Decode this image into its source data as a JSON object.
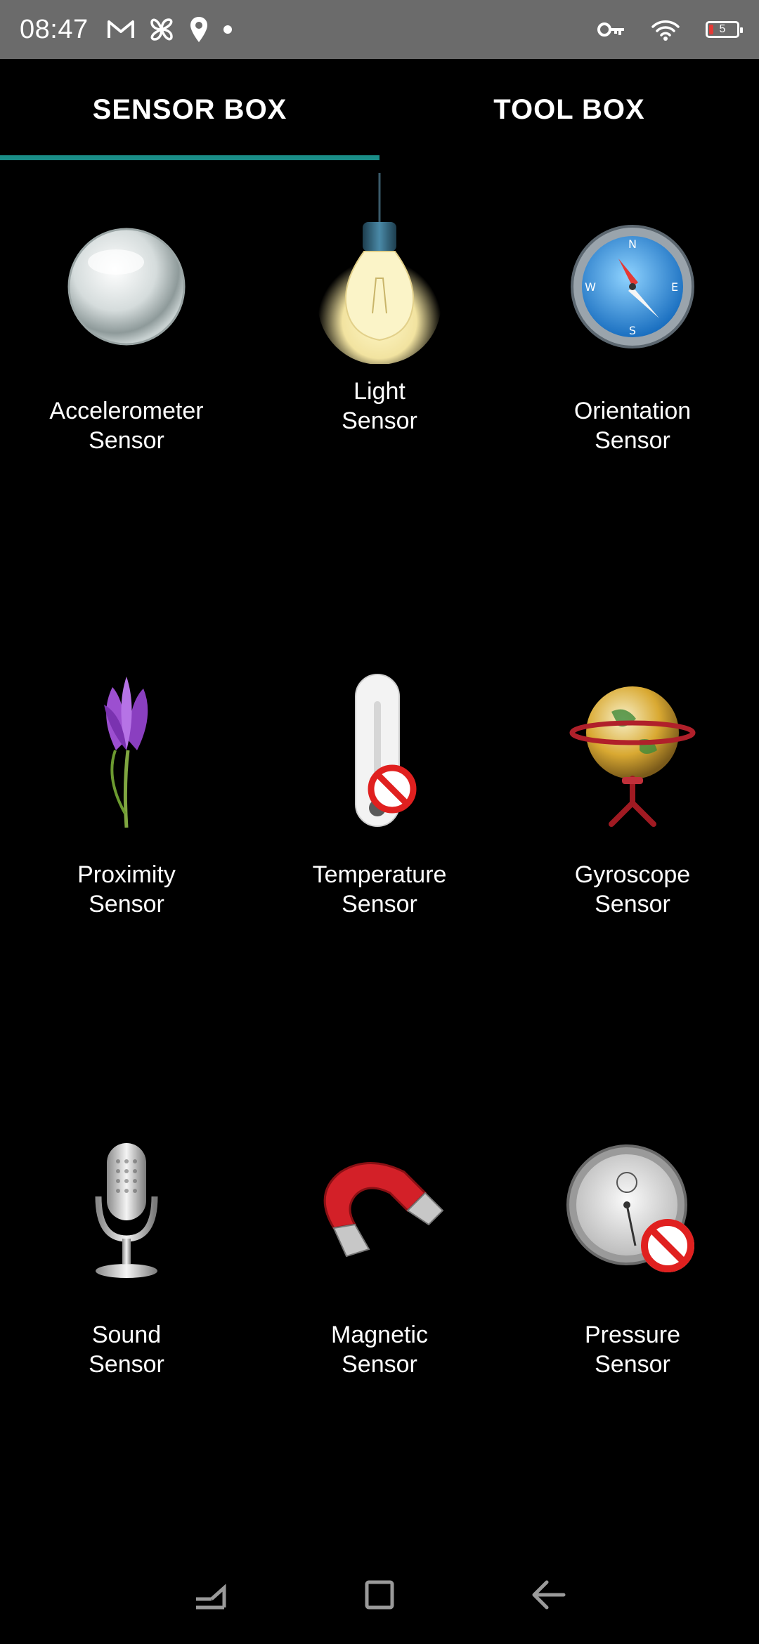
{
  "status_bar": {
    "time": "08:47",
    "battery_level": "5",
    "icons": [
      "gmail-icon",
      "pinwheel-icon",
      "location-icon",
      "notification-dot-icon",
      "vpn-key-icon",
      "wifi-icon",
      "battery-icon"
    ]
  },
  "tabs": [
    {
      "label": "SENSOR BOX",
      "selected": true
    },
    {
      "label": "TOOL BOX",
      "selected": false
    }
  ],
  "accent_color": "#1a8e88",
  "sensors": [
    {
      "label": "Accelerometer\nSensor",
      "icon": "glass-ball-icon"
    },
    {
      "label": "Light\nSensor",
      "icon": "light-bulb-icon"
    },
    {
      "label": "Orientation\nSensor",
      "icon": "compass-icon"
    },
    {
      "label": "Proximity\nSensor",
      "icon": "flower-icon"
    },
    {
      "label": "Temperature\nSensor",
      "icon": "thermometer-icon",
      "unavailable": true
    },
    {
      "label": "Gyroscope\nSensor",
      "icon": "globe-icon"
    },
    {
      "label": "Sound\nSensor",
      "icon": "microphone-icon"
    },
    {
      "label": "Magnetic\nSensor",
      "icon": "magnet-icon"
    },
    {
      "label": "Pressure\nSensor",
      "icon": "stopwatch-icon",
      "unavailable": true
    }
  ],
  "nav_bar": {
    "buttons": [
      "recents-icon",
      "home-icon",
      "back-icon"
    ]
  }
}
